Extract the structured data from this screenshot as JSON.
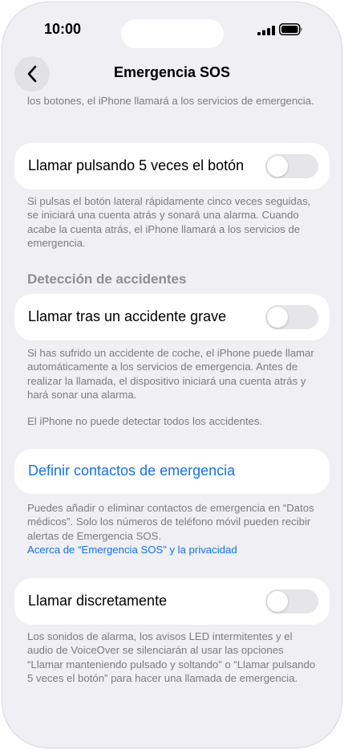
{
  "status_bar": {
    "time": "10:00"
  },
  "nav": {
    "title": "Emergencia SOS"
  },
  "top_footer": "los botones, el iPhone llamará a los servicios de emergencia.",
  "five_press": {
    "label": "Llamar pulsando 5 veces el botón",
    "enabled": false,
    "footer": "Si pulsas el botón lateral rápidamente cinco veces seguidas, se iniciará una cuenta atrás y sonará una alarma. Cuando acabe la cuenta atrás, el iPhone llamará a los servicios de emergencia."
  },
  "crash_detection": {
    "header": "Detección de accidentes",
    "label": "Llamar tras un accidente grave",
    "enabled": false,
    "footer_1": "Si has sufrido un accidente de coche, el iPhone puede llamar automáticamente a los servicios de emergencia. Antes de realizar la llamada, el dispositivo iniciará una cuenta atrás y hará sonar una alarma.",
    "footer_2": "El iPhone no puede detectar todos los accidentes."
  },
  "contacts": {
    "label": "Definir contactos de emergencia",
    "footer": "Puedes añadir o eliminar contactos de emergencia en “Datos médicos”. Solo los números de teléfono móvil pueden recibir alertas de Emergencia SOS.",
    "privacy_link": "Acerca de “Emergencia SOS” y la privacidad"
  },
  "silent": {
    "label": "Llamar discretamente",
    "enabled": false,
    "footer": "Los sonidos de alarma, los avisos LED intermitentes y el audio de VoiceOver se silenciarán al usar las opciones “Llamar manteniendo pulsado y soltando” o “Llamar pulsando 5 veces el botón” para hacer una llamada de emergencia."
  },
  "colors": {
    "accent": "#1473e6",
    "background": "#efeff4",
    "toggle_off": "#e5e5ea"
  },
  "icons": {
    "back": "chevron-left-icon",
    "signal": "cellular-signal-icon",
    "battery": "battery-icon"
  }
}
